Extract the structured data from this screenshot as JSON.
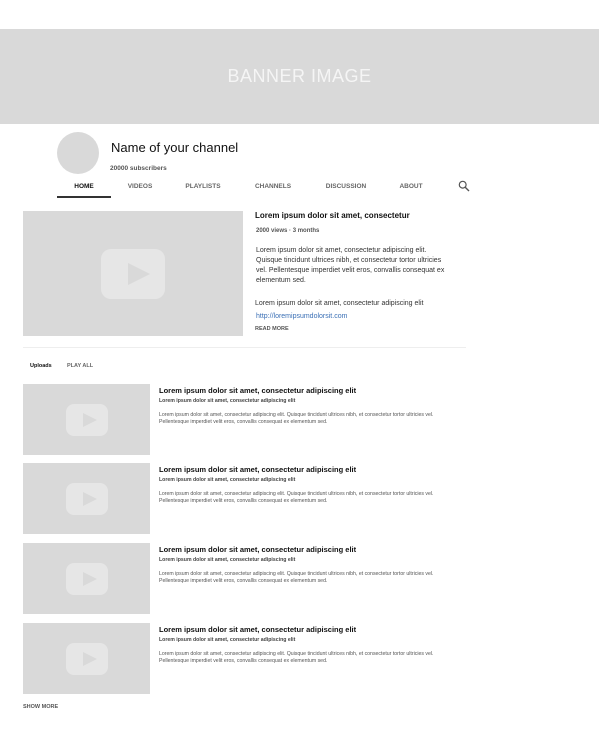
{
  "banner": {
    "text": "BANNER IMAGE"
  },
  "channel": {
    "name": "Name of your channel",
    "subscribers": "20000 subscribers"
  },
  "tabs": [
    {
      "label": "HOME",
      "active": true
    },
    {
      "label": "VIDEOS"
    },
    {
      "label": "PLAYLISTS"
    },
    {
      "label": "CHANNELS"
    },
    {
      "label": "DISCUSSION"
    },
    {
      "label": "ABOUT"
    }
  ],
  "icons": {
    "search": "search-icon",
    "play": "play-icon"
  },
  "featured": {
    "title": "Lorem ipsum dolor sit amet, consectetur",
    "meta": "2000 views · 3 months",
    "description": "Lorem ipsum dolor sit amet, consectetur adipiscing elit. Quisque tincidunt ultrices nibh, et consectetur tortor ultricies vel. Pellentesque imperdiet velit eros, convallis consequat ex elementum sed.",
    "line": "Lorem ipsum dolor sit amet, consectetur adipiscing elit",
    "link": "http://loremipsumdolorsit.com",
    "read_more": "READ MORE"
  },
  "uploads": {
    "label": "Uploads",
    "play_all": "PLAY ALL",
    "videos": [
      {
        "title": "Lorem ipsum dolor sit amet, consectetur adipiscing elit",
        "subtitle": "Lorem ipsum dolor sit amet, consectetur adipiscing elit",
        "description": "Lorem ipsum dolor sit amet, consectetur adipiscing elit. Quisque tincidunt ultrices nibh, et consectetur tortor ultricies vel. Pellentesque imperdiet velit eros, convallis consequat ex elementum sed."
      },
      {
        "title": "Lorem ipsum dolor sit amet, consectetur adipiscing elit",
        "subtitle": "Lorem ipsum dolor sit amet, consectetur adipiscing elit",
        "description": "Lorem ipsum dolor sit amet, consectetur adipiscing elit. Quisque tincidunt ultrices nibh, et consectetur tortor ultricies vel. Pellentesque imperdiet velit eros, convallis consequat ex elementum sed."
      },
      {
        "title": "Lorem ipsum dolor sit amet, consectetur adipiscing elit",
        "subtitle": "Lorem ipsum dolor sit amet, consectetur adipiscing elit",
        "description": "Lorem ipsum dolor sit amet, consectetur adipiscing elit. Quisque tincidunt ultrices nibh, et consectetur tortor ultricies vel. Pellentesque imperdiet velit eros, convallis consequat ex elementum sed."
      },
      {
        "title": "Lorem ipsum dolor sit amet, consectetur adipiscing elit",
        "subtitle": "Lorem ipsum dolor sit amet, consectetur adipiscing elit",
        "description": "Lorem ipsum dolor sit amet, consectetur adipiscing elit. Quisque tincidunt ultrices nibh, et consectetur tortor ultricies vel. Pellentesque imperdiet velit eros, convallis consequat ex elementum sed."
      }
    ],
    "show_more": "SHOW MORE"
  }
}
